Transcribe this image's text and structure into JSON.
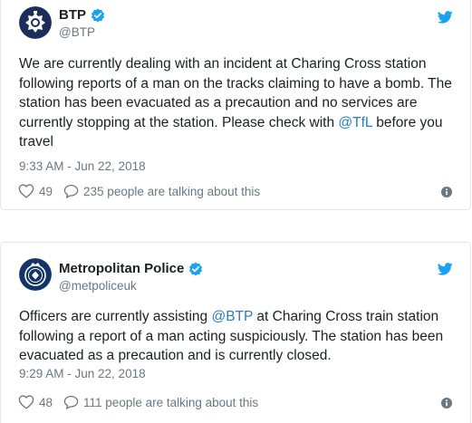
{
  "tweets": [
    {
      "display_name": "BTP",
      "handle": "@BTP",
      "text_before": "We are currently dealing with an incident at Charing Cross station following reports of a man on the tracks claiming to have a bomb. The station has been evacuated as a precaution and no services are currently stopping at the station. Please check with ",
      "mention": "@TfL",
      "text_after": " before you travel",
      "timestamp": "9:33 AM - Jun 22, 2018",
      "likes": "49",
      "talking": "235 people are talking about this",
      "icons": [
        "avatar",
        "verified-icon",
        "twitter-bird-icon",
        "heart-icon",
        "reply-bubble-icon",
        "info-icon"
      ]
    },
    {
      "display_name": "Metropolitan Police",
      "handle": "@metpoliceuk",
      "text_before": "Officers are currently assisting ",
      "mention": "@BTP",
      "text_after": " at Charing Cross train station following a report of a man acting suspiciously. The station has been evacuated as a precaution and is currently closed.",
      "timestamp": "9:29 AM - Jun 22, 2018",
      "likes": "48",
      "talking": "111 people are talking about this",
      "icons": [
        "avatar",
        "verified-icon",
        "twitter-bird-icon",
        "heart-icon",
        "reply-bubble-icon",
        "info-icon"
      ]
    }
  ],
  "colors": {
    "link": "#2b7bb9",
    "twitter_blue": "#1da1f2",
    "muted": "#697882",
    "text": "#1c2022",
    "border": "#e1e8ed"
  }
}
